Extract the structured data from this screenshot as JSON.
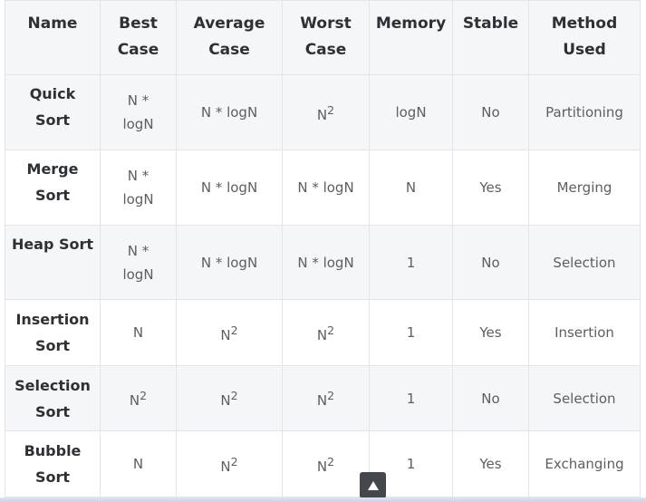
{
  "table": {
    "headers": {
      "name": "Name",
      "best_1": "Best",
      "best_2": "Case",
      "avg_1": "Average",
      "avg_2": "Case",
      "worst_1": "Worst",
      "worst_2": "Case",
      "memory": "Memory",
      "stable": "Stable",
      "method_1": "Method",
      "method_2": "Used"
    },
    "rows": [
      {
        "name_1": "Quick Sort",
        "name_2": "",
        "best_1": "N *",
        "best_2": "logN",
        "average": "N * logN",
        "worst_base": "N",
        "worst_exp": "2",
        "memory": "logN",
        "stable": "No",
        "method": "Partitioning"
      },
      {
        "name_1": "Merge",
        "name_2": "Sort",
        "best_1": "N *",
        "best_2": "logN",
        "average": "N * logN",
        "worst": "N * logN",
        "memory": "N",
        "stable": "Yes",
        "method": "Merging"
      },
      {
        "name_1": "Heap Sort",
        "name_2": "",
        "best_1": "N *",
        "best_2": "logN",
        "average": "N * logN",
        "worst": "N * logN",
        "memory": "1",
        "stable": "No",
        "method": "Selection"
      },
      {
        "name_1": "Insertion",
        "name_2": "Sort",
        "best": "N",
        "average_base": "N",
        "average_exp": "2",
        "worst_base": "N",
        "worst_exp": "2",
        "memory": "1",
        "stable": "Yes",
        "method": "Insertion"
      },
      {
        "name_1": "Selection",
        "name_2": "Sort",
        "best_base": "N",
        "best_exp": "2",
        "average_base": "N",
        "average_exp": "2",
        "worst_base": "N",
        "worst_exp": "2",
        "memory": "1",
        "stable": "No",
        "method": "Selection"
      },
      {
        "name_1": "Bubble",
        "name_2": "Sort",
        "best": "N",
        "average_base": "N",
        "average_exp": "2",
        "worst_base": "N",
        "worst_exp": "2",
        "memory": "1",
        "stable": "Yes",
        "method": "Exchanging"
      }
    ]
  },
  "scroll_top": {
    "icon": "triangle-up-icon"
  },
  "colors": {
    "header_text": "#2d3135",
    "cell_text": "#5a5f65",
    "border": "#e3e5ea",
    "stripe": "#f5f6f7",
    "scroll_button_bg": "#44484c"
  }
}
